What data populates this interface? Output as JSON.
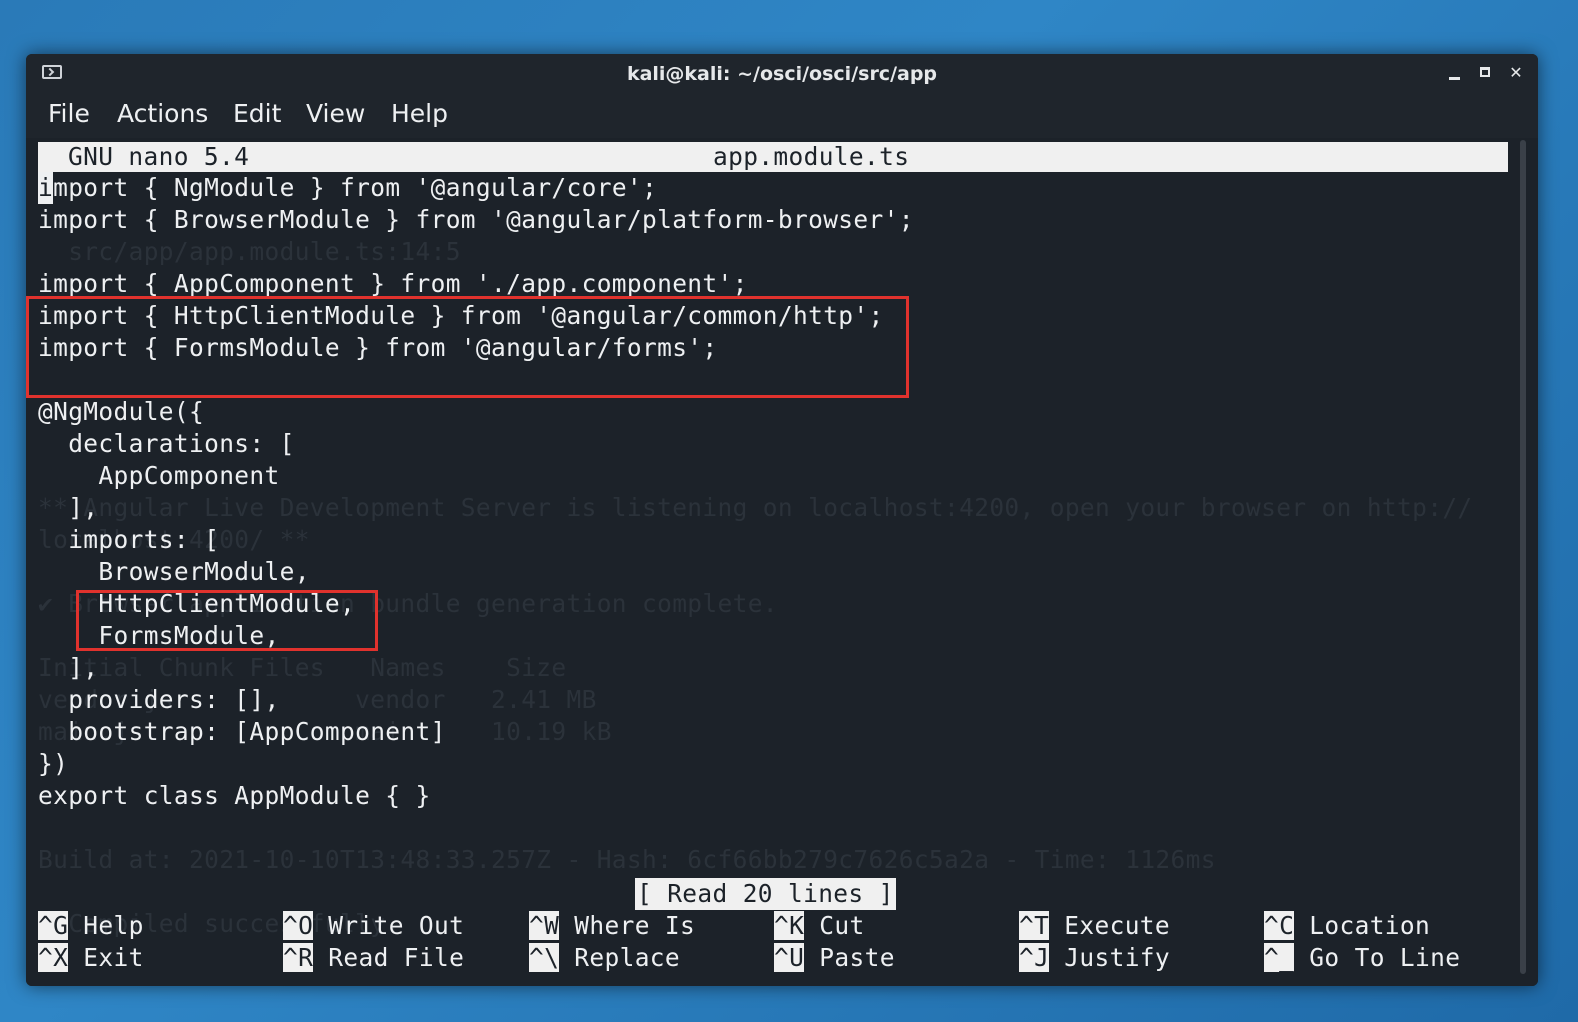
{
  "window": {
    "title": "kali@kali: ~/osci/osci/src/app",
    "icon": "terminal-icon"
  },
  "menu": [
    "File",
    "Actions",
    "Edit",
    "View",
    "Help"
  ],
  "nano": {
    "version_label": "GNU nano 5.4",
    "filename": "app.module.ts",
    "status": "[ Read 20 lines ]"
  },
  "code": [
    "import { NgModule } from '@angular/core';",
    "import { BrowserModule } from '@angular/platform-browser';",
    "",
    "import { AppComponent } from './app.component';",
    "import { HttpClientModule } from '@angular/common/http';",
    "import { FormsModule } from '@angular/forms';",
    "",
    "@NgModule({",
    "  declarations: [",
    "    AppComponent",
    "  ],",
    "  imports: [",
    "    BrowserModule,",
    "    HttpClientModule,",
    "    FormsModule,",
    "  ],",
    "  providers: [],",
    "  bootstrap: [AppComponent]",
    "})",
    "export class AppModule { }"
  ],
  "background_text": [
    {
      "line": 2,
      "text": "  src/app/app.module.ts:14:5"
    },
    {
      "line": 10,
      "text": "** Angular Live Development Server is listening on localhost:4200, open your browser on http://"
    },
    {
      "line": 11,
      "text": "localhost:4200/ **"
    },
    {
      "line": 13,
      "text": "✔ Browser application bundle generation complete."
    },
    {
      "line": 15,
      "text": "Initial Chunk Files   Names    Size"
    },
    {
      "line": 16,
      "text": "vendor.js            vendor   2.41 MB"
    },
    {
      "line": 17,
      "text": "main.js              main     10.19 kB"
    },
    {
      "line": 21,
      "text": "Build at: 2021-10-10T13:48:33.257Z - Hash: 6cf66bb279c7626c5a2a - Time: 1126ms"
    },
    {
      "line": 23,
      "text": "  Compiled successfully."
    }
  ],
  "shortcuts": [
    [
      {
        "key": "^G",
        "label": "Help"
      },
      {
        "key": "^X",
        "label": "Exit"
      }
    ],
    [
      {
        "key": "^O",
        "label": "Write Out"
      },
      {
        "key": "^R",
        "label": "Read File"
      }
    ],
    [
      {
        "key": "^W",
        "label": "Where Is"
      },
      {
        "key": "^\\",
        "label": "Replace"
      }
    ],
    [
      {
        "key": "^K",
        "label": "Cut"
      },
      {
        "key": "^U",
        "label": "Paste"
      }
    ],
    [
      {
        "key": "^T",
        "label": "Execute"
      },
      {
        "key": "^J",
        "label": "Justify"
      }
    ],
    [
      {
        "key": "^C",
        "label": "Location"
      },
      {
        "key": "^_",
        "label": "Go To Line"
      }
    ]
  ],
  "highlight_color": "#e0322d"
}
